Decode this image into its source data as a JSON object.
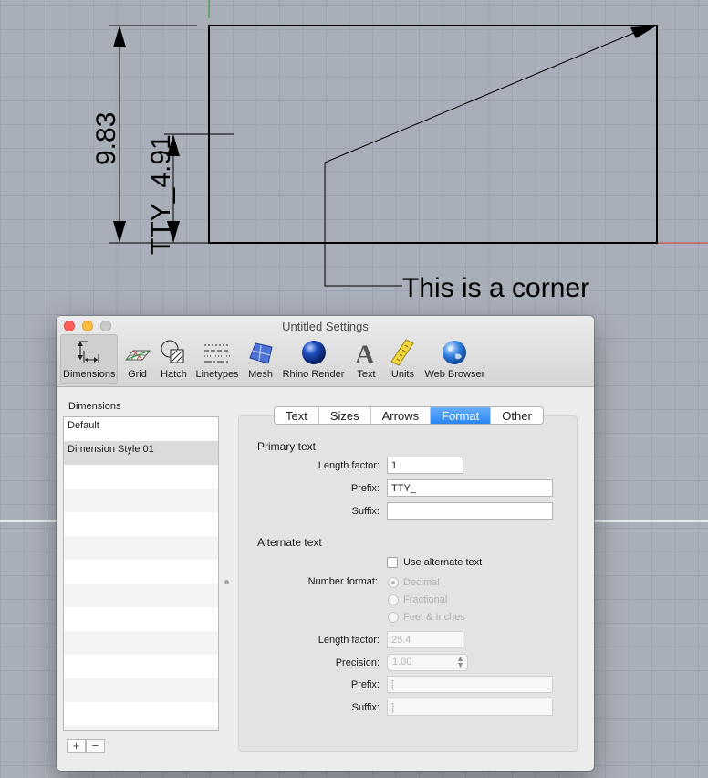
{
  "viewport": {
    "annotation_text": "This is a corner",
    "dim_outer_text": "9.83",
    "dim_inner_text": "TTY_4.91"
  },
  "window": {
    "title": "Untitled Settings"
  },
  "toolbar": {
    "items": [
      {
        "label": "Dimensions",
        "icon": "dimensions-icon",
        "active": true
      },
      {
        "label": "Grid",
        "icon": "grid-icon"
      },
      {
        "label": "Hatch",
        "icon": "hatch-icon"
      },
      {
        "label": "Linetypes",
        "icon": "linetypes-icon"
      },
      {
        "label": "Mesh",
        "icon": "mesh-icon"
      },
      {
        "label": "Rhino Render",
        "icon": "rhino-render-icon"
      },
      {
        "label": "Text",
        "icon": "text-icon"
      },
      {
        "label": "Units",
        "icon": "units-icon"
      },
      {
        "label": "Web Browser",
        "icon": "web-browser-icon"
      }
    ]
  },
  "sidebar": {
    "heading": "Dimensions",
    "items": [
      "Default",
      "Dimension Style 01"
    ],
    "selected": "Dimension Style 01",
    "add_label": "+",
    "remove_label": "−"
  },
  "tabs": {
    "items": [
      "Text",
      "Sizes",
      "Arrows",
      "Format",
      "Other"
    ],
    "active": "Format"
  },
  "primary": {
    "title": "Primary text",
    "length_factor_label": "Length factor:",
    "length_factor_value": "1",
    "prefix_label": "Prefix:",
    "prefix_value": "TTY_",
    "suffix_label": "Suffix:",
    "suffix_value": ""
  },
  "alternate": {
    "title": "Alternate text",
    "use_alternate_label": "Use alternate text",
    "use_alternate_checked": false,
    "number_format_label": "Number format:",
    "number_formats": [
      "Decimal",
      "Fractional",
      "Feet & Inches"
    ],
    "number_format_selected": "Decimal",
    "length_factor_label": "Length factor:",
    "length_factor_value": "25.4",
    "precision_label": "Precision:",
    "precision_value": "1.00",
    "prefix_label": "Prefix:",
    "prefix_value": "[",
    "suffix_label": "Suffix:",
    "suffix_value": "]"
  },
  "colors": {
    "viewport_bg": "#a9afb8",
    "accent": "#2a85f1",
    "x_axis": "#d63b2f",
    "y_axis": "#2f9a3a"
  }
}
